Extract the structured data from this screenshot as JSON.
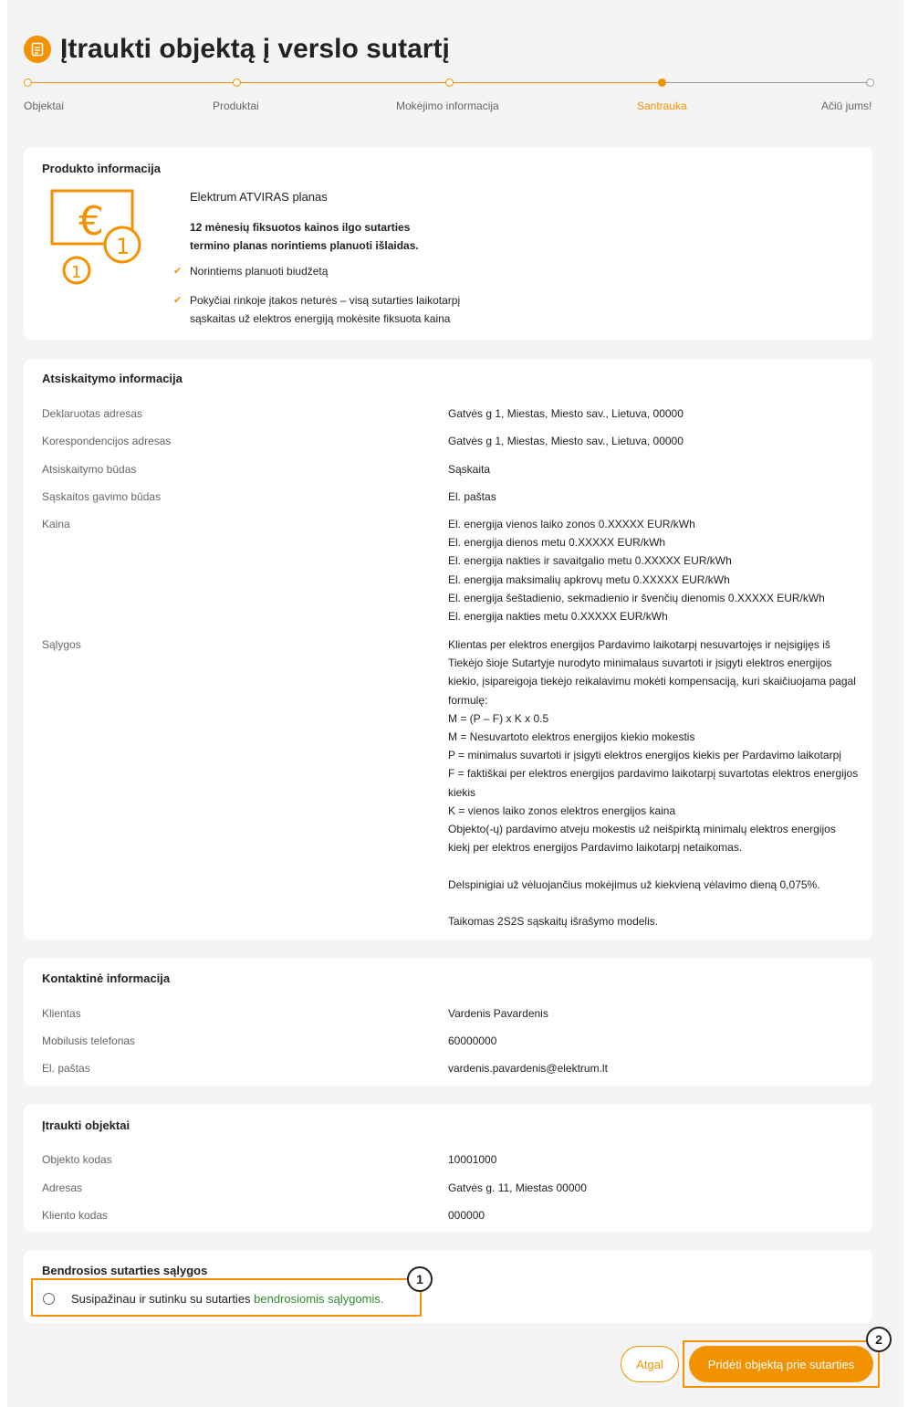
{
  "header": {
    "title": "Įtraukti objektą į verslo sutartį",
    "icon": "document-icon"
  },
  "stepper": {
    "steps": [
      {
        "label": "Objektai",
        "state": "done"
      },
      {
        "label": "Produktai",
        "state": "done"
      },
      {
        "label": "Mokėjimo informacija",
        "state": "done"
      },
      {
        "label": "Santrauka",
        "state": "active"
      },
      {
        "label": "Ačiū jums!",
        "state": "future"
      }
    ]
  },
  "product": {
    "section_title": "Produkto informacija",
    "plan_name": "Elektrum ATVIRAS planas",
    "description_line1": "12 mėnesių fiksuotos kainos ilgo sutarties",
    "description_line2": "termino planas norintiems planuoti išlaidas.",
    "benefit1": "Norintiems planuoti biudžetą",
    "benefit2_line1": "Pokyčiai rinkoje įtakos neturės – visą sutarties laikotarpį",
    "benefit2_line2": "sąskaitas už elektros energiją mokėsite fiksuota kaina",
    "icon": "euro-fixed-price-icon"
  },
  "billing": {
    "section_title": "Atsiskaitymo informacija",
    "declared_address_label": "Deklaruotas adresas",
    "declared_address": "Gatvės g 1, Miestas, Miesto sav., Lietuva, 00000",
    "correspondence_address_label": "Korespondencijos adresas",
    "correspondence_address": "Gatvės g 1, Miestas, Miesto sav., Lietuva, 00000",
    "payment_method_label": "Atsiskaitymo būdas",
    "payment_method": "Sąskaita",
    "invoice_delivery_label": "Sąskaitos gavimo būdas",
    "invoice_delivery": "El. paštas",
    "price_label": "Kaina",
    "prices": [
      "El. energija vienos laiko zonos 0.XXXXX EUR/kWh",
      "El. energija dienos metu 0.XXXXX EUR/kWh",
      "El. energija nakties ir savaitgalio metu 0.XXXXX EUR/kWh",
      "El. energija maksimalių apkrovų metu 0.XXXXX EUR/kWh",
      "El. energija šeštadienio, sekmadienio ir švenčių dienomis 0.XXXXX EUR/kWh",
      "El. energija nakties metu 0.XXXXX EUR/kWh"
    ],
    "conditions_label": "Sąlygos",
    "conditions": [
      "Klientas per elektros energijos Pardavimo laikotarpį nesuvartojęs ir neįsigijęs iš",
      "Tiekėjo šioje Sutartyje nurodyto minimalaus suvartoti ir įsigyti elektros energijos",
      "kiekio, įsipareigoja tiekėjo reikalavimu mokėti kompensaciją, kuri skaičiuojama pagal",
      "formulę:",
      "M = (P – F) x K x 0.5",
      "M = Nesuvartoto elektros energijos kiekio mokestis",
      "P = minimalus suvartoti ir įsigyti elektros energijos kiekis per Pardavimo laikotarpį",
      "F = faktiškai per elektros energijos pardavimo laikotarpį suvartotas elektros energijos",
      "kiekis",
      "K = vienos laiko zonos elektros energijos kaina",
      "Objekto(-ų) pardavimo atveju mokestis už neišpirktą minimalų elektros energijos",
      "kiekį per elektros energijos Pardavimo laikotarpį netaikomas.",
      "",
      "Delspinigiai už vėluojančius mokėjimus už kiekvieną vėlavimo dieną 0,075%.",
      "",
      "Taikomas 2S2S sąskaitų išrašymo modelis."
    ]
  },
  "contact": {
    "section_title": "Kontaktinė informacija",
    "client_label": "Klientas",
    "client": "Vardenis Pavardenis",
    "mobile_label": "Mobilusis telefonas",
    "mobile": "60000000",
    "email_label": "El. paštas",
    "email": "vardenis.pavardenis@elektrum.lt"
  },
  "objects": {
    "section_title": "Įtraukti objektai",
    "code_label": "Objekto kodas",
    "code": "10001000",
    "address_label": "Adresas",
    "address": "Gatvės g. 11, Miestas 00000",
    "client_code_label": "Kliento kodas",
    "client_code": "000000"
  },
  "terms": {
    "section_title": "Bendrosios sutarties sąlygos",
    "consent_text": "Susipažinau ir sutinku su sutarties ",
    "consent_link": "bendrosiomis sąlygomis."
  },
  "actions": {
    "back_label": "Atgal",
    "add_label": "Pridėti objektą prie sutarties"
  },
  "annotations": {
    "badge1": "1",
    "badge2": "2"
  },
  "colors": {
    "accent": "#f39200",
    "link": "#2e8b2e"
  }
}
